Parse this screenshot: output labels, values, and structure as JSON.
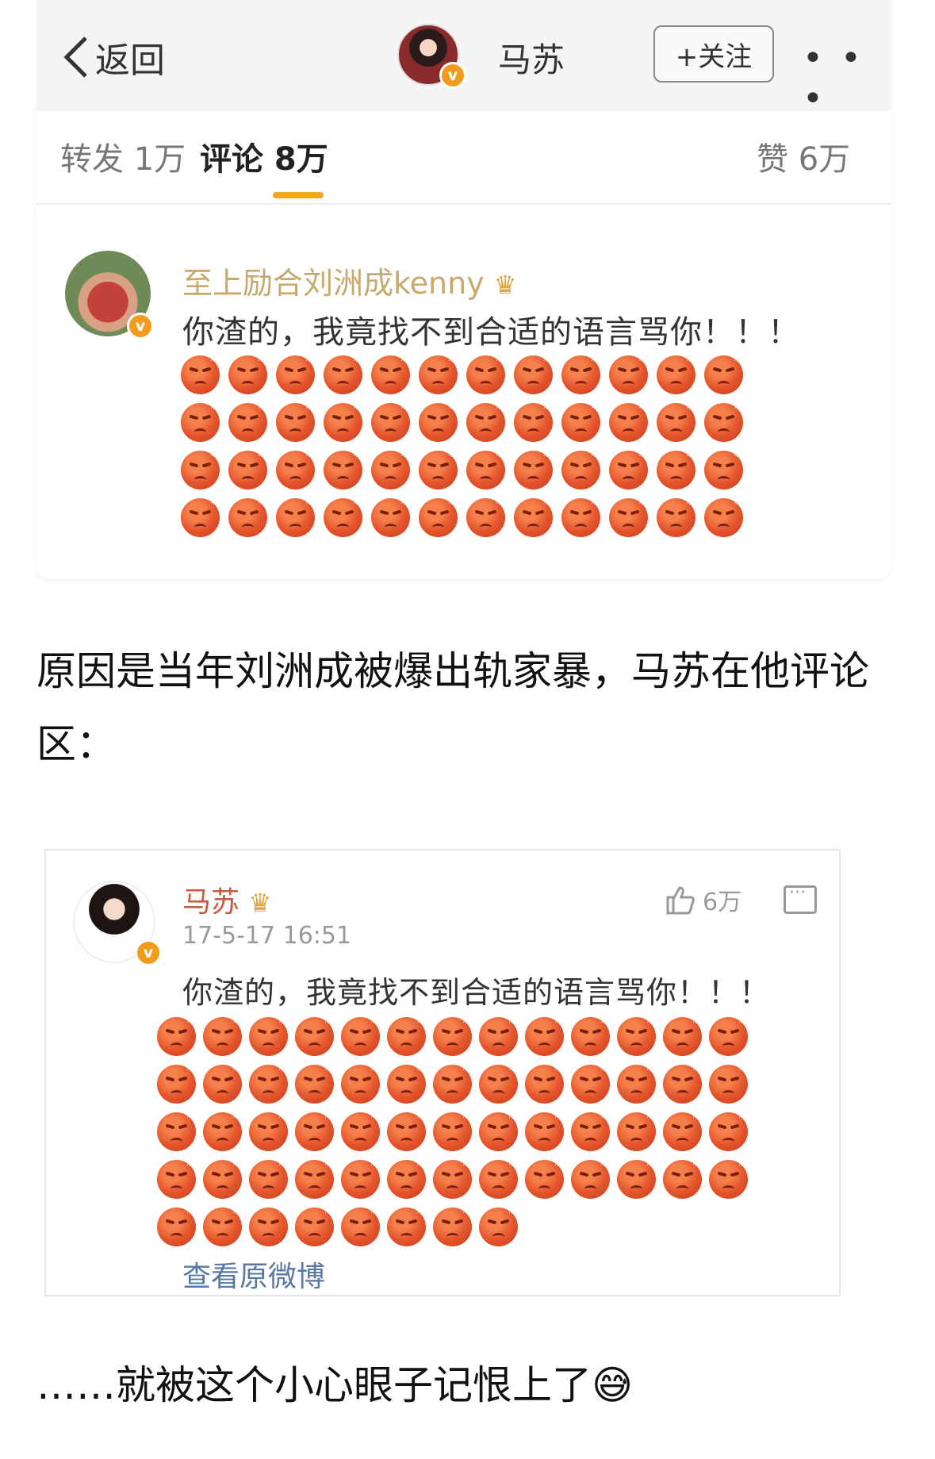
{
  "header": {
    "back_label": "返回",
    "user_name": "马苏",
    "follow_label": "+关注",
    "more_label": "• • •"
  },
  "tabs": [
    {
      "label": "转发 1万"
    },
    {
      "label": "评论 8万"
    },
    {
      "label": "赞 6万"
    }
  ],
  "comment1": {
    "author": "至上励合刘洲成kenny",
    "text": "你渣的，我竟找不到合适的语言骂你！！！",
    "emoji_name": "angry-face",
    "emoji_count": 48
  },
  "narrative1": "原因是当年刘洲成被爆出轨家暴，马苏在他评论区：",
  "comment2": {
    "author": "马苏",
    "time": "17-5-17 16:51",
    "likes": "6万",
    "text": "你渣的，我竟找不到合适的语言骂你！！！",
    "emoji_name": "angry-face",
    "emoji_count": 60,
    "view_original": "查看原微博"
  },
  "narrative2": "……就被这个小心眼子记恨上了",
  "narrative2_emoji": "😅",
  "colors": {
    "accent_orange": "#f5a623",
    "vip_badge": "#f29b1d",
    "gold_name": "#c5a96e",
    "link_blue": "#5778a6"
  }
}
